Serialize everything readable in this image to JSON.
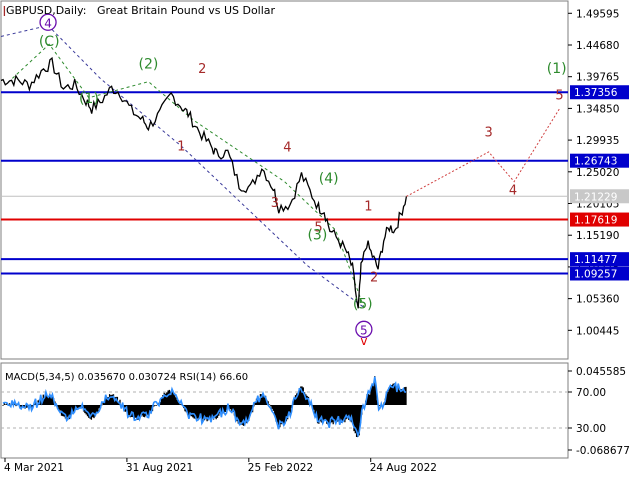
{
  "header": {
    "symbol": "GBPUSD,Daily:",
    "description": "Great Britain Pound vs US Dollar"
  },
  "colors": {
    "price_line": "#000000",
    "level_blue": "#0000cc",
    "level_red": "#e00000",
    "label_blue_bg": "#0000cc",
    "label_red_bg": "#e00000",
    "current_price_bg": "#c8c8c8",
    "wave_green": "#2e8b2e",
    "wave_brown": "#a52a2a",
    "wave_purple": "#6a0dad",
    "dashed_navy": "#3a3a9a",
    "dashed_green": "#2e8b2e",
    "forecast_red": "#d04040",
    "macd_hist": "#000000",
    "rsi_line": "#2f8fff",
    "axis_text": "#000000"
  },
  "price_axis": {
    "ticks": [
      "1.49595",
      "1.44680",
      "1.39765",
      "1.34850",
      "1.29935",
      "1.25020",
      "1.20105",
      "1.15190",
      "1.10275",
      "1.05360",
      "1.00445"
    ],
    "ymin": 0.96,
    "ymax": 1.515
  },
  "levels": [
    {
      "value": 1.37356,
      "label": "1.37356",
      "kind": "blue"
    },
    {
      "value": 1.26743,
      "label": "1.26743",
      "kind": "blue"
    },
    {
      "value": 1.17619,
      "label": "1.17619",
      "kind": "red"
    },
    {
      "value": 1.11477,
      "label": "1.11477",
      "kind": "blue"
    },
    {
      "value": 1.09257,
      "label": "1.09257",
      "kind": "blue"
    }
  ],
  "current_price": {
    "value": 1.21229,
    "label": "1.21229"
  },
  "time_axis": {
    "labels": [
      {
        "label": "4 Mar 2021",
        "x": 0.0
      },
      {
        "label": "31 Aug 2021",
        "x": 0.2
      },
      {
        "label": "25 Feb 2022",
        "x": 0.4
      },
      {
        "label": "24 Aug 2022",
        "x": 0.6
      }
    ]
  },
  "chart_data": {
    "type": "line",
    "title": "GBPUSD,Daily: Great Britain Pound vs US Dollar",
    "xlabel": "",
    "ylabel": "",
    "x_dates": [
      "4 Mar 2021",
      "31 Aug 2021",
      "25 Feb 2022",
      "24 Aug 2022"
    ],
    "series": [
      {
        "name": "GBPUSD",
        "x": [
          0.0,
          0.03,
          0.05,
          0.075,
          0.09,
          0.11,
          0.13,
          0.15,
          0.16,
          0.175,
          0.195,
          0.21,
          0.23,
          0.25,
          0.26,
          0.28,
          0.3,
          0.32,
          0.33,
          0.35,
          0.37,
          0.38,
          0.4,
          0.42,
          0.44,
          0.46,
          0.48,
          0.49,
          0.51,
          0.53,
          0.545,
          0.56,
          0.57,
          0.58,
          0.595,
          0.61,
          0.62,
          0.63,
          0.635,
          0.645,
          0.655,
          0.665,
          0.675,
          0.685,
          0.695,
          0.705,
          0.715
        ],
        "values": [
          1.392,
          1.392,
          1.385,
          1.41,
          1.418,
          1.38,
          1.385,
          1.36,
          1.348,
          1.358,
          1.38,
          1.373,
          1.345,
          1.33,
          1.32,
          1.34,
          1.37,
          1.35,
          1.34,
          1.312,
          1.29,
          1.278,
          1.28,
          1.23,
          1.225,
          1.258,
          1.225,
          1.195,
          1.2,
          1.245,
          1.22,
          1.195,
          1.19,
          1.16,
          1.145,
          1.125,
          1.1,
          1.035,
          1.1,
          1.14,
          1.12,
          1.1,
          1.145,
          1.165,
          1.16,
          1.185,
          1.212
        ]
      }
    ],
    "wave_labels": [
      {
        "text": "(1)",
        "x": 0.155,
        "y": 1.357,
        "color": "green"
      },
      {
        "text": "(2)",
        "x": 0.26,
        "y": 1.41,
        "color": "green"
      },
      {
        "text": "2",
        "x": 0.355,
        "y": 1.403,
        "color": "brown"
      },
      {
        "text": "1",
        "x": 0.318,
        "y": 1.283,
        "color": "brown"
      },
      {
        "text": "4",
        "x": 0.505,
        "y": 1.282,
        "color": "brown"
      },
      {
        "text": "3",
        "x": 0.483,
        "y": 1.196,
        "color": "brown"
      },
      {
        "text": "(4)",
        "x": 0.578,
        "y": 1.233,
        "color": "green"
      },
      {
        "text": "5",
        "x": 0.56,
        "y": 1.158,
        "color": "brown"
      },
      {
        "text": "(3)",
        "x": 0.558,
        "y": 1.145,
        "color": "green"
      },
      {
        "text": "1",
        "x": 0.648,
        "y": 1.19,
        "color": "brown"
      },
      {
        "text": "2",
        "x": 0.658,
        "y": 1.08,
        "color": "brown"
      },
      {
        "text": "(5)",
        "x": 0.638,
        "y": 1.038,
        "color": "green"
      },
      {
        "text": "3",
        "x": 0.762,
        "y": 1.305,
        "color": "brown"
      },
      {
        "text": "4",
        "x": 0.802,
        "y": 1.215,
        "color": "brown"
      },
      {
        "text": "5",
        "x": 0.873,
        "y": 1.362,
        "color": "brown"
      },
      {
        "text": "(1)",
        "x": 0.868,
        "y": 1.403,
        "color": "green"
      },
      {
        "text": "(C)",
        "x": 0.085,
        "y": 1.445,
        "color": "green"
      },
      {
        "text": "I",
        "x": 0.006,
        "y": 1.492,
        "color": "brown"
      }
    ],
    "circled_labels": [
      {
        "text": "4",
        "x": 0.083,
        "y": 1.482
      },
      {
        "text": "5",
        "x": 0.64,
        "y": 1.006
      }
    ],
    "v_label": {
      "text": "v",
      "x": 0.64,
      "y": 0.982
    }
  },
  "macd_panel": {
    "label": "MACD(5,34,5) 0.035670 0.030724 RSI(14) 66.60",
    "axis_ticks": [
      "0.045585",
      "70.00",
      "30.00",
      "-0.068677"
    ],
    "ymax": 0.045585,
    "ymin": -0.068677,
    "rsi_levels": [
      70,
      30
    ]
  }
}
